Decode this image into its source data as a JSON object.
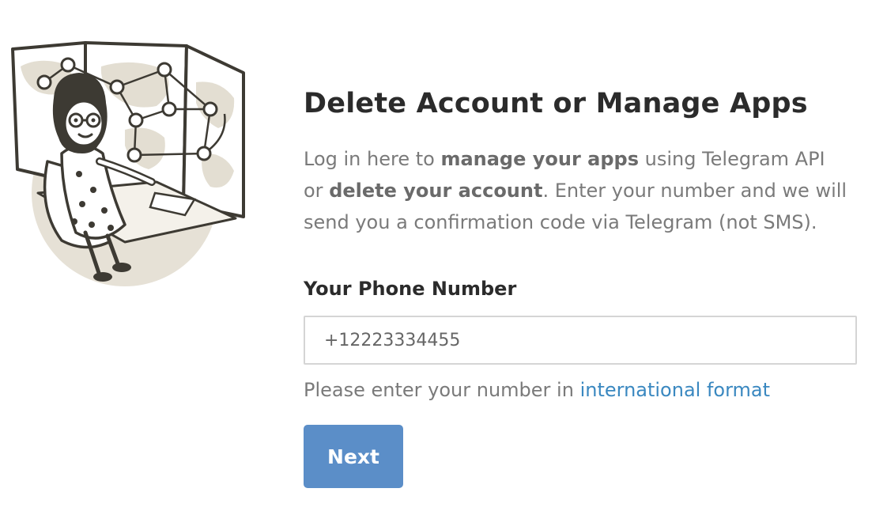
{
  "page": {
    "title": "Delete Account or Manage Apps",
    "intro": {
      "part1": "Log in here to ",
      "bold1": "manage your apps",
      "part2": " using Telegram API or ",
      "bold2": "delete your account",
      "part3": ". Enter your number and we will send you a confirmation code via Telegram (not SMS)."
    }
  },
  "form": {
    "phone_label": "Your Phone Number",
    "phone_value": "+12223334455",
    "hint_text": "Please enter your number in ",
    "hint_link": "international format",
    "next_label": "Next"
  },
  "illustration": {
    "icon": "woman-at-world-map-illustration"
  },
  "colors": {
    "accent": "#5b8ec8",
    "link": "#3a88c0",
    "text": "#2b2b2b",
    "muted": "#7a7a7a"
  }
}
